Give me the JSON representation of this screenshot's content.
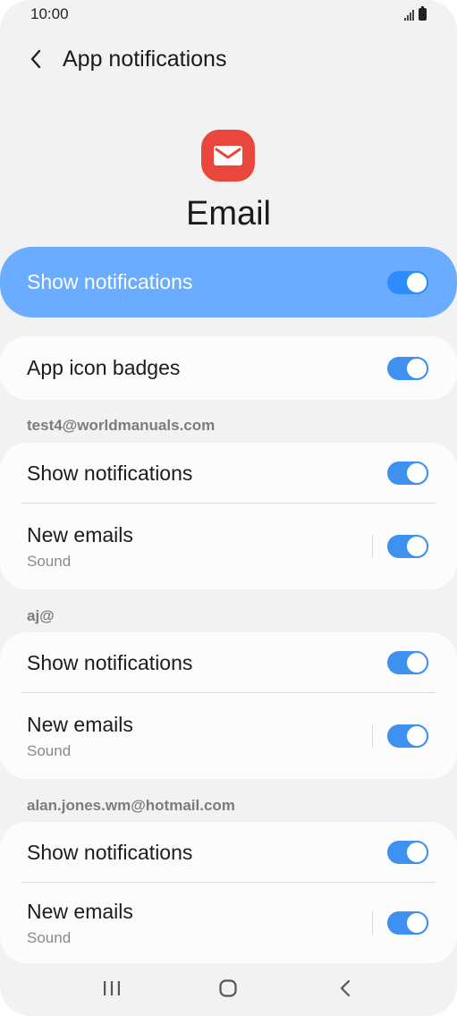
{
  "status_bar": {
    "time": "10:00"
  },
  "header": {
    "title": "App notifications"
  },
  "app": {
    "name": "Email",
    "icon": "email-envelope-icon",
    "icon_color": "#e9463c"
  },
  "master_toggle": {
    "label": "Show notifications",
    "on": true
  },
  "badges": {
    "label": "App icon badges",
    "on": true
  },
  "accounts": [
    {
      "email": "test4@worldmanuals.com",
      "show_label": "Show notifications",
      "new_label": "New emails",
      "new_sub": "Sound"
    },
    {
      "email": "aj@",
      "show_label": "Show notifications",
      "new_label": "New emails",
      "new_sub": "Sound"
    },
    {
      "email": "alan.jones.wm@hotmail.com",
      "show_label": "Show notifications",
      "new_label": "New emails",
      "new_sub": "Sound"
    }
  ],
  "colors": {
    "accent": "#3e91ef",
    "highlight": "#6aacff"
  },
  "nav": {
    "icons": [
      "recents-icon",
      "home-icon",
      "back-icon"
    ]
  }
}
